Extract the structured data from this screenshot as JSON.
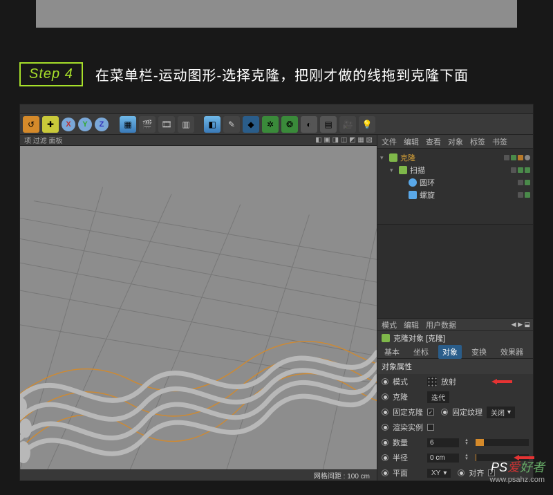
{
  "step": {
    "label": "Step 4",
    "text": "在菜单栏-运动图形-选择克隆，把刚才做的线拖到克隆下面"
  },
  "toolbar": {
    "xyz": [
      "X",
      "Y",
      "Z"
    ]
  },
  "viewport": {
    "top_left": "项  过滤  面板",
    "status": "网格间距 : 100 cm"
  },
  "obj_panel": {
    "tabs": [
      "文件",
      "编辑",
      "查看",
      "对象",
      "标签",
      "书签"
    ],
    "hierarchy": [
      {
        "name": "克隆",
        "color": "#7fb84a",
        "indent": 0,
        "sel": true
      },
      {
        "name": "扫描",
        "color": "#7fb84a",
        "indent": 1
      },
      {
        "name": "圆环",
        "color": "#5aa8e8",
        "indent": 2
      },
      {
        "name": "螺旋",
        "color": "#5aa8e8",
        "indent": 2
      }
    ]
  },
  "attr": {
    "top_tabs": [
      "模式",
      "编辑",
      "用户数据"
    ],
    "title": "克隆对象 [克隆]",
    "tabs": [
      "基本",
      "坐标",
      "对象",
      "变换",
      "效果器"
    ],
    "active_tab": "对象",
    "section": "对象属性",
    "rows": {
      "mode_label": "模式",
      "mode_value": "放射",
      "clone_label": "克隆",
      "clone_value": "迭代",
      "fixed_label": "固定克隆",
      "fixed_check": "✓",
      "fixed_tex_label": "固定纹理",
      "fixed_tex_value": "关闭",
      "render_label": "渲染实例",
      "count_label": "数量",
      "count_value": "6",
      "radius_label": "半径",
      "radius_value": "0 cm",
      "plane_label": "平面",
      "plane_value": "XY",
      "align_label": "对齐",
      "align_check": "✓"
    }
  },
  "watermark": {
    "line1a": "PS",
    "line1b": "爱",
    "line1c": "好者",
    "line2": "www.psahz.com"
  }
}
